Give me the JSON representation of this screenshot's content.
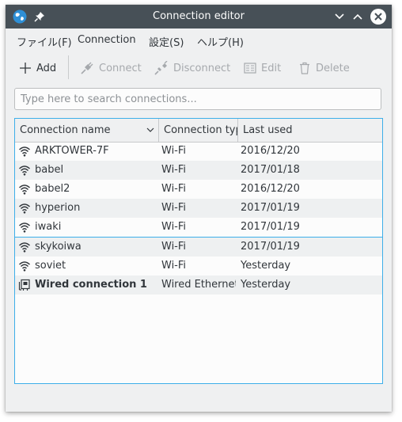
{
  "window": {
    "title": "Connection editor"
  },
  "menu": [
    "ファイル(F)",
    "Connection",
    "設定(S)",
    "ヘルプ(H)"
  ],
  "toolbar": {
    "add": "Add",
    "connect": "Connect",
    "disconnect": "Disconnect",
    "edit": "Edit",
    "delete": "Delete"
  },
  "search": {
    "placeholder": "Type here to search connections...",
    "value": ""
  },
  "table": {
    "columns": [
      "Connection name",
      "Connection typ",
      "Last used"
    ],
    "rows": [
      {
        "icon": "wifi-icon",
        "name": "ARKTOWER-7F",
        "type": "Wi-Fi",
        "last_used": "2016/12/20",
        "bold": false
      },
      {
        "icon": "wifi-icon",
        "name": "babel",
        "type": "Wi-Fi",
        "last_used": "2017/01/18",
        "bold": false
      },
      {
        "icon": "wifi-icon",
        "name": "babel2",
        "type": "Wi-Fi",
        "last_used": "2016/12/20",
        "bold": false
      },
      {
        "icon": "wifi-icon",
        "name": "hyperion",
        "type": "Wi-Fi",
        "last_used": "2017/01/19",
        "bold": false
      },
      {
        "icon": "wifi-icon",
        "name": "iwaki",
        "type": "Wi-Fi",
        "last_used": "2017/01/19",
        "bold": false
      },
      {
        "icon": "wifi-icon",
        "name": "skykoiwa",
        "type": "Wi-Fi",
        "last_used": "2017/01/19",
        "bold": false
      },
      {
        "icon": "wifi-icon",
        "name": "soviet",
        "type": "Wi-Fi",
        "last_used": "Yesterday",
        "bold": false
      },
      {
        "icon": "wired-icon",
        "name": "Wired connection 1",
        "type": "Wired Ethernet",
        "last_used": "Yesterday",
        "bold": true
      }
    ]
  },
  "colors": {
    "titlebar": "#475057",
    "accent": "#3daee9",
    "window_bg": "#eff0f1"
  }
}
